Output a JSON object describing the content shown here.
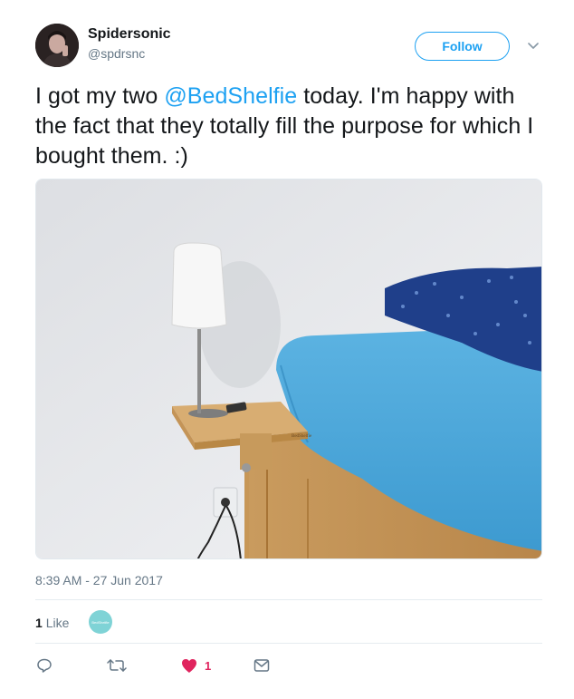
{
  "user": {
    "name": "Spidersonic",
    "handle": "@spdrsnc"
  },
  "follow_label": "Follow",
  "tweet": {
    "text_before": "I got my two ",
    "mention": "@BedShelfie",
    "text_after": " today. I'm happy with the fact that they totally fill the purpose for which I bought them. :)",
    "timestamp": "8:39 AM - 27 Jun 2017",
    "product_brand": "BedShelfie"
  },
  "stats": {
    "like_count": "1",
    "like_label": "Like"
  },
  "liker_avatar_text": "BedShelfie",
  "actions": {
    "reply_icon": "reply-icon",
    "retweet_icon": "retweet-icon",
    "like_icon": "heart-icon",
    "like_count": "1",
    "dm_icon": "direct-message-icon"
  },
  "colors": {
    "accent": "#1da1f2",
    "like": "#e0245e",
    "secondary_text": "#657786"
  }
}
